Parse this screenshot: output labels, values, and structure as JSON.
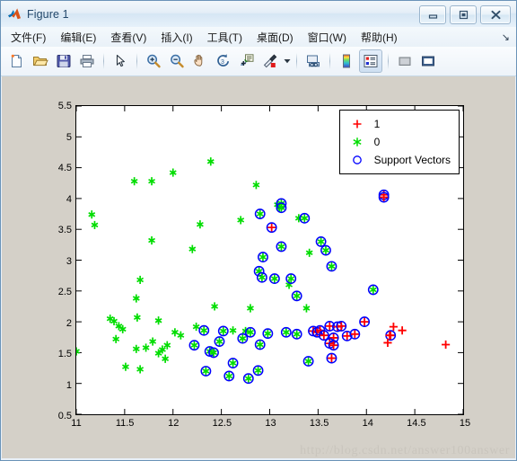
{
  "window": {
    "title": "Figure 1",
    "icon": "matlab-icon",
    "buttons": [
      {
        "name": "minimize-button",
        "glyph": "minimize"
      },
      {
        "name": "maximize-button",
        "glyph": "maximize"
      },
      {
        "name": "close-button",
        "glyph": "close"
      }
    ]
  },
  "menubar": {
    "items": [
      {
        "name": "menu-file",
        "label": "文件(F)"
      },
      {
        "name": "menu-edit",
        "label": "编辑(E)"
      },
      {
        "name": "menu-view",
        "label": "查看(V)"
      },
      {
        "name": "menu-insert",
        "label": "插入(I)"
      },
      {
        "name": "menu-tools",
        "label": "工具(T)"
      },
      {
        "name": "menu-desktop",
        "label": "桌面(D)"
      },
      {
        "name": "menu-window",
        "label": "窗口(W)"
      },
      {
        "name": "menu-help",
        "label": "帮助(H)"
      }
    ],
    "overflow": "↘"
  },
  "toolbar": {
    "items": [
      {
        "name": "new-figure-icon",
        "type": "new"
      },
      {
        "name": "open-file-icon",
        "type": "open"
      },
      {
        "name": "save-figure-icon",
        "type": "save"
      },
      {
        "name": "print-figure-icon",
        "type": "print"
      },
      {
        "name": "separator-1",
        "type": "sep"
      },
      {
        "name": "edit-plot-pointer-icon",
        "type": "pointer"
      },
      {
        "name": "separator-2",
        "type": "sep"
      },
      {
        "name": "zoom-in-icon",
        "type": "zoom-in"
      },
      {
        "name": "zoom-out-icon",
        "type": "zoom-out"
      },
      {
        "name": "pan-icon",
        "type": "pan"
      },
      {
        "name": "rotate-3d-icon",
        "type": "rotate3d"
      },
      {
        "name": "data-cursor-icon",
        "type": "datacursor"
      },
      {
        "name": "brush-icon",
        "type": "brush"
      },
      {
        "name": "brush-dropdown-arrow-icon",
        "type": "arrow"
      },
      {
        "name": "separator-3",
        "type": "sep"
      },
      {
        "name": "link-plot-icon",
        "type": "link"
      },
      {
        "name": "separator-4",
        "type": "sep"
      },
      {
        "name": "colorbar-icon",
        "type": "colorbar"
      },
      {
        "name": "legend-icon",
        "type": "legend",
        "pressed": true
      },
      {
        "name": "separator-5",
        "type": "sep"
      },
      {
        "name": "hide-plot-tools-icon",
        "type": "hidetools"
      },
      {
        "name": "show-plot-tools-icon",
        "type": "showtools"
      }
    ]
  },
  "figure": {
    "watermark": "http://blog.csdn.net/answer100answer"
  },
  "chart_data": {
    "type": "scatter",
    "title": "",
    "xlabel": "",
    "ylabel": "",
    "xlim": [
      11,
      15
    ],
    "ylim": [
      0.5,
      5.5
    ],
    "xticks": [
      11,
      11.5,
      12,
      12.5,
      13,
      13.5,
      14,
      14.5,
      15
    ],
    "xticklabels": [
      "11",
      "11.5",
      "12",
      "12.5",
      "13",
      "13.5",
      "14",
      "14.5",
      "15"
    ],
    "yticks": [
      0.5,
      1,
      1.5,
      2,
      2.5,
      3,
      3.5,
      4,
      4.5,
      5,
      5.5
    ],
    "yticklabels": [
      "0.5",
      "1",
      "1.5",
      "2",
      "2.5",
      "3",
      "3.5",
      "4",
      "4.5",
      "5",
      "5.5"
    ],
    "grid": false,
    "legend": {
      "position": "top-right",
      "entries": [
        {
          "label": "1",
          "marker": "plus",
          "color": "#ff0000"
        },
        {
          "label": "0",
          "marker": "asterisk",
          "color": "#00dd00"
        },
        {
          "label": "Support Vectors",
          "marker": "circle",
          "color": "#0000ff"
        }
      ]
    },
    "colors": {
      "class1": "#ff0000",
      "class0": "#00dd00",
      "support_vector": "#0000ff",
      "axes_background": "#ffffff",
      "figure_background": "#d4d0c8"
    },
    "series": [
      {
        "name": "0",
        "marker": "asterisk",
        "color": "#00dd00",
        "points": [
          [
            11.16,
            3.74
          ],
          [
            11.6,
            4.28
          ],
          [
            11.78,
            4.28
          ],
          [
            12.0,
            4.42
          ],
          [
            12.39,
            4.6
          ],
          [
            12.86,
            4.22
          ],
          [
            11.19,
            3.57
          ],
          [
            12.28,
            3.58
          ],
          [
            12.7,
            3.65
          ],
          [
            11.78,
            3.32
          ],
          [
            12.2,
            3.18
          ],
          [
            11.66,
            2.68
          ],
          [
            11.62,
            2.38
          ],
          [
            11.35,
            2.05
          ],
          [
            11.39,
            2.01
          ],
          [
            11.44,
            1.93
          ],
          [
            11.48,
            1.88
          ],
          [
            11.63,
            2.07
          ],
          [
            11.85,
            2.02
          ],
          [
            12.02,
            1.83
          ],
          [
            11.41,
            1.72
          ],
          [
            11.62,
            1.56
          ],
          [
            11.72,
            1.58
          ],
          [
            11.79,
            1.68
          ],
          [
            11.85,
            1.49
          ],
          [
            11.89,
            1.55
          ],
          [
            11.92,
            1.4
          ],
          [
            11.94,
            1.62
          ],
          [
            12.08,
            1.78
          ],
          [
            11.0,
            1.52
          ],
          [
            11.51,
            1.27
          ],
          [
            11.66,
            1.23
          ],
          [
            12.24,
            1.92
          ],
          [
            12.62,
            1.86
          ],
          [
            12.75,
            1.85
          ],
          [
            12.43,
            2.25
          ],
          [
            13.08,
            3.9
          ],
          [
            13.1,
            3.85
          ],
          [
            13.3,
            3.68
          ],
          [
            13.41,
            3.12
          ],
          [
            13.2,
            2.6
          ],
          [
            12.8,
            2.22
          ],
          [
            13.38,
            2.22
          ]
        ]
      },
      {
        "name": "1",
        "marker": "plus",
        "color": "#ff0000",
        "points": [
          [
            14.28,
            1.92
          ],
          [
            14.37,
            1.86
          ],
          [
            14.24,
            1.78
          ],
          [
            14.22,
            1.66
          ],
          [
            14.82,
            1.63
          ]
        ]
      },
      {
        "name": "Support Vectors",
        "marker": "circle",
        "color": "#0000ff",
        "points": [
          [
            12.9,
            3.75
          ],
          [
            13.12,
            3.92
          ],
          [
            13.12,
            3.85
          ],
          [
            13.36,
            3.68
          ],
          [
            13.02,
            3.53
          ],
          [
            13.12,
            3.22
          ],
          [
            12.93,
            3.05
          ],
          [
            12.89,
            2.82
          ],
          [
            13.05,
            2.7
          ],
          [
            13.22,
            2.7
          ],
          [
            13.64,
            2.9
          ],
          [
            13.58,
            3.16
          ],
          [
            13.53,
            3.3
          ],
          [
            14.07,
            2.52
          ],
          [
            13.28,
            2.42
          ],
          [
            12.92,
            2.72
          ],
          [
            14.18,
            4.06
          ],
          [
            14.18,
            4.02
          ],
          [
            12.32,
            1.86
          ],
          [
            12.52,
            1.85
          ],
          [
            12.8,
            1.83
          ],
          [
            12.98,
            1.81
          ],
          [
            12.72,
            1.73
          ],
          [
            12.9,
            1.63
          ],
          [
            13.17,
            1.83
          ],
          [
            13.28,
            1.8
          ],
          [
            13.45,
            1.85
          ],
          [
            13.49,
            1.83
          ],
          [
            13.52,
            1.86
          ],
          [
            13.56,
            1.78
          ],
          [
            13.62,
            1.93
          ],
          [
            13.7,
            1.92
          ],
          [
            13.74,
            1.93
          ],
          [
            13.66,
            1.74
          ],
          [
            13.8,
            1.77
          ],
          [
            13.88,
            1.8
          ],
          [
            13.62,
            1.65
          ],
          [
            13.66,
            1.62
          ],
          [
            13.98,
            2.0
          ],
          [
            14.25,
            1.78
          ],
          [
            13.64,
            1.41
          ],
          [
            13.4,
            1.36
          ],
          [
            12.38,
            1.52
          ],
          [
            12.42,
            1.5
          ],
          [
            12.34,
            1.2
          ],
          [
            12.58,
            1.12
          ],
          [
            12.78,
            1.08
          ],
          [
            12.88,
            1.21
          ],
          [
            12.62,
            1.33
          ],
          [
            12.48,
            1.68
          ],
          [
            12.22,
            1.62
          ]
        ]
      }
    ]
  }
}
